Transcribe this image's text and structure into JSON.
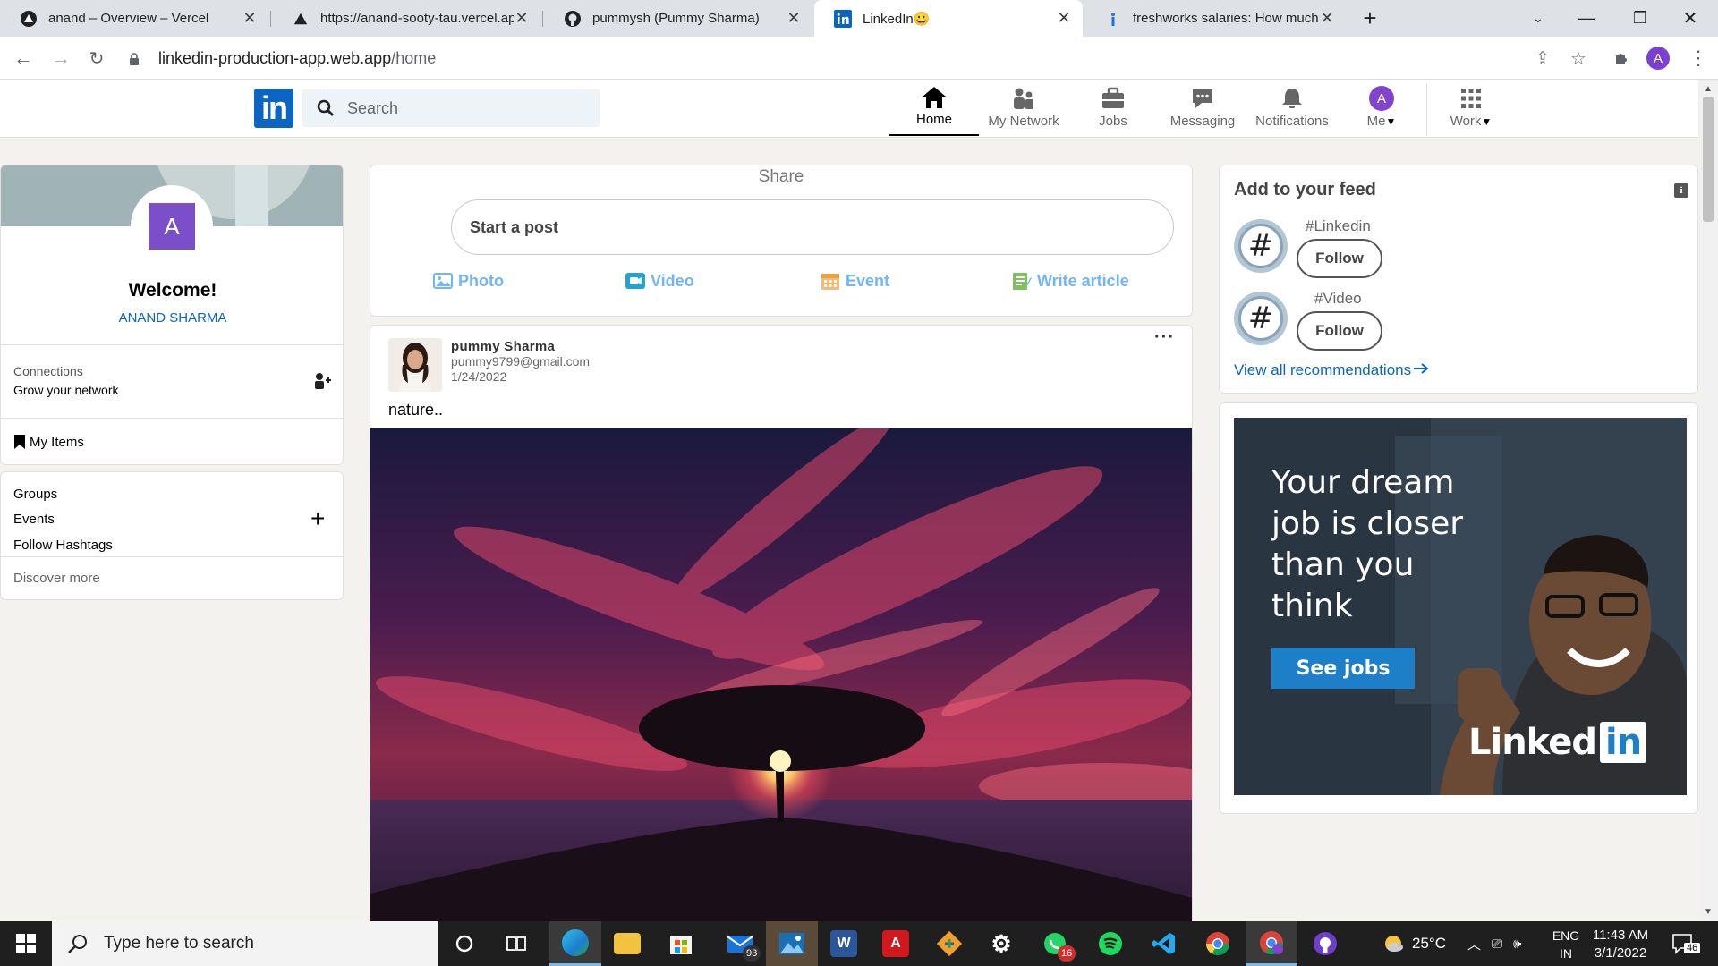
{
  "browser": {
    "tabs": [
      {
        "title": "anand – Overview – Vercel",
        "icon": "vercel-icon"
      },
      {
        "title": "https://anand-sooty-tau.vercel.app",
        "icon": "vercel-icon"
      },
      {
        "title": "pummysh (Pummy Sharma)",
        "icon": "github-icon"
      },
      {
        "title": "LinkedIn😀",
        "icon": "linkedin-icon"
      },
      {
        "title": "freshworks salaries: How much do",
        "icon": "glassdoor-icon"
      }
    ],
    "url_host": "linkedin-production-app.web.app",
    "url_path": "/home",
    "profile_initial": "A"
  },
  "header": {
    "logo_text": "in",
    "search_placeholder": "Search",
    "nav": [
      {
        "label": "Home",
        "icon": "home-icon",
        "active": true
      },
      {
        "label": "My Network",
        "icon": "network-icon"
      },
      {
        "label": "Jobs",
        "icon": "briefcase-icon"
      },
      {
        "label": "Messaging",
        "icon": "messaging-icon"
      },
      {
        "label": "Notifications",
        "icon": "bell-icon"
      },
      {
        "label": "Me",
        "icon": "avatar-icon",
        "initial": "A"
      },
      {
        "label": "Work",
        "icon": "grid-icon"
      }
    ]
  },
  "sidebar": {
    "avatar_initial": "A",
    "welcome": "Welcome!",
    "user_name": "ANAND SHARMA",
    "connections_label": "Connections",
    "connections_sub": "Grow your network",
    "my_items": "My Items",
    "links": [
      "Groups",
      "Events",
      "Follow Hashtags"
    ],
    "discover_more": "Discover more"
  },
  "share": {
    "title": "Share",
    "start_post": "Start a post",
    "options": [
      {
        "label": "Photo",
        "icon": "photo-icon",
        "color": "#70b5f9"
      },
      {
        "label": "Video",
        "icon": "video-icon",
        "color": "#7fc15e"
      },
      {
        "label": "Event",
        "icon": "event-icon",
        "color": "#e7a33e"
      },
      {
        "label": "Write article",
        "icon": "article-icon",
        "color": "#fc9295"
      }
    ]
  },
  "post": {
    "author": "pummy Sharma",
    "email": "pummy9799@gmail.com",
    "date": "1/24/2022",
    "more": "···",
    "text": "nature.."
  },
  "feed": {
    "title": "Add to your feed",
    "info": "i",
    "items": [
      {
        "tag": "#Linkedin",
        "button": "Follow"
      },
      {
        "tag": "#Video",
        "button": "Follow"
      }
    ],
    "view_all": "View all recommendations"
  },
  "ad": {
    "headline": "Your dream job is closer than you think",
    "cta": "See jobs",
    "brand_a": "Linked",
    "brand_b": "in"
  },
  "taskbar": {
    "search_placeholder": "Type here to search",
    "mail_badge": "93",
    "whatsapp_badge": "16",
    "temperature": "25°C",
    "lang_line1": "ENG",
    "lang_line2": "IN",
    "time": "11:43 AM",
    "date": "3/1/2022",
    "notif_count": "46"
  },
  "colors": {
    "linkedin_blue": "#0a66c2",
    "page_bg": "#f3f2ef",
    "share_photo": "#70b5f9"
  }
}
